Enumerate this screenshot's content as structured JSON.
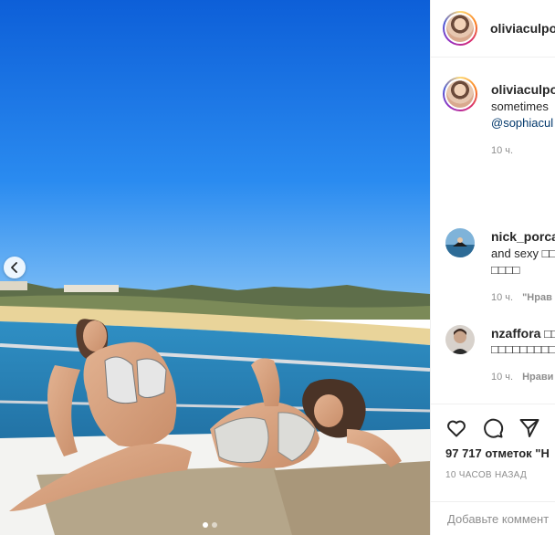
{
  "post": {
    "carousel": {
      "total_slides": 2,
      "current_slide": 1
    }
  },
  "header": {
    "username": "oliviaculpo"
  },
  "caption": {
    "username": "oliviaculpo",
    "text": "sometimes",
    "mention": "@sophiacul",
    "time": "10 ч."
  },
  "comments": [
    {
      "username": "nick_porcar",
      "line1": "and sexy □□",
      "line2": "□□□□",
      "time": "10 ч.",
      "reply": "\"Нрав"
    },
    {
      "username": "nzaffora",
      "line1": "□□",
      "line2": "□□□□□□□□□□",
      "time": "10 ч.",
      "reply": "Нрави"
    }
  ],
  "actions": {
    "like_icon": "heart-icon",
    "comment_icon": "comment-icon",
    "share_icon": "share-icon",
    "likes": "97 717 отметок \"Н",
    "timestamp": "10 ЧАСОВ НАЗАД"
  },
  "add_comment": {
    "placeholder": "Добавьте коммент"
  },
  "colors": {
    "sky": "#1b6fe0",
    "sea": "#2a7fb8",
    "link": "#00376b",
    "muted": "#8e8e8e"
  }
}
